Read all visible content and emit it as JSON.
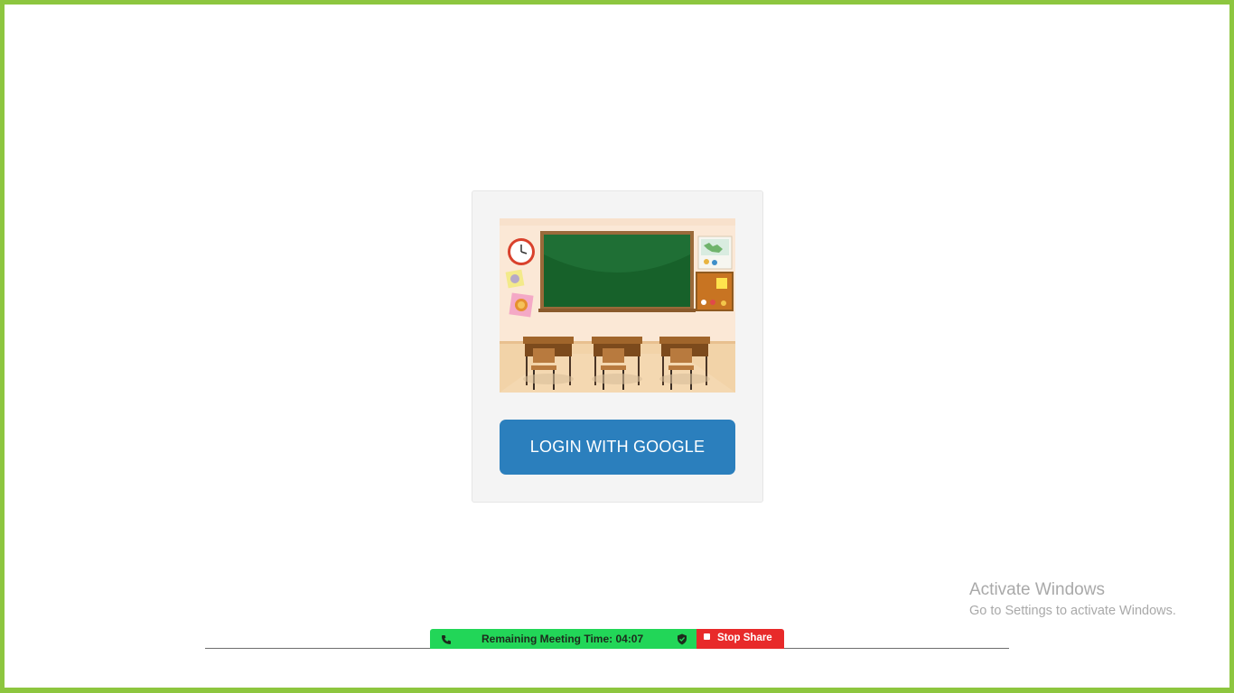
{
  "login": {
    "button_label": "LOGIN WITH GOOGLE"
  },
  "illustration": {
    "icon": "classroom-illustration"
  },
  "meeting_bar": {
    "remaining_time_text": "Remaining Meeting Time: 04:07",
    "phone_icon": "phone-icon",
    "shield_icon": "shield-check-icon",
    "stop_share_label": "Stop Share"
  },
  "windows_watermark": {
    "title": "Activate Windows",
    "subtitle": "Go to Settings to activate Windows."
  },
  "colors": {
    "frame_border": "#8dc63f",
    "button_bg": "#2b7fbd",
    "meeting_bar_bg": "#22d658",
    "stop_share_bg": "#e82a2a"
  }
}
